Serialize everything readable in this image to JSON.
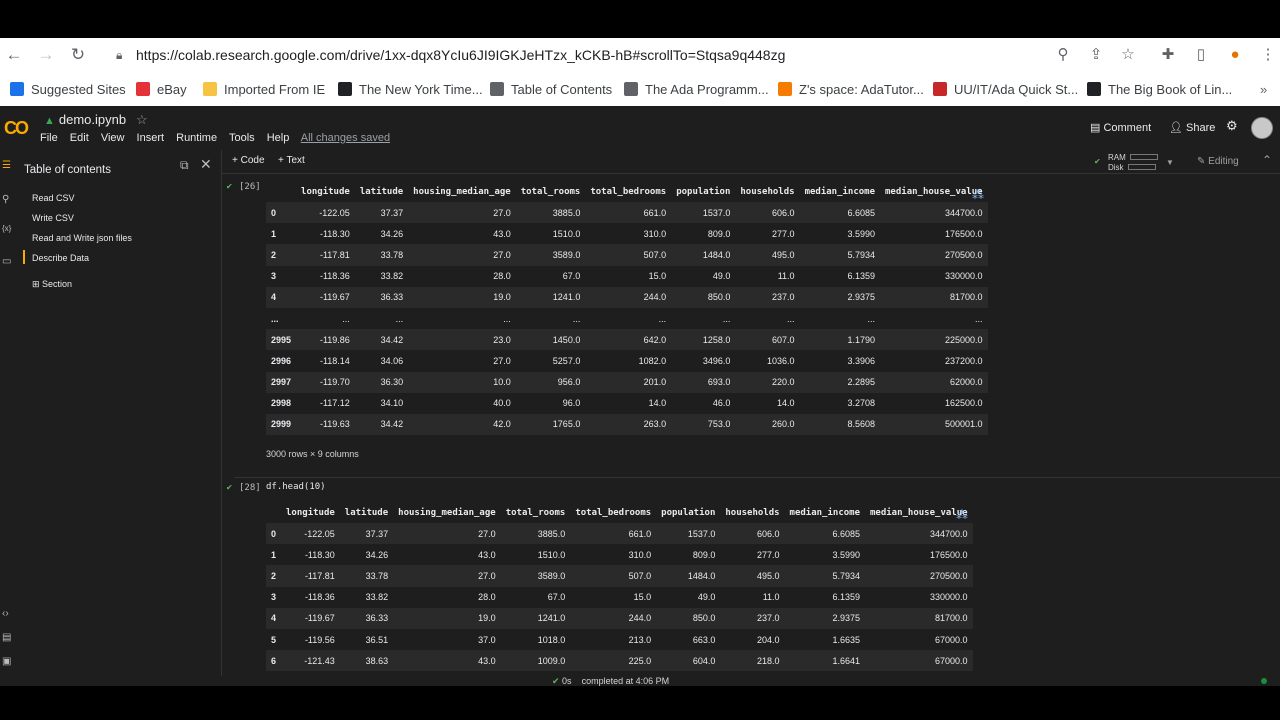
{
  "browser": {
    "url": "https://colab.research.google.com/drive/1xx-dqx8YcIu6JI9IGKJeHTzx_kCKB-hB#scrollTo=Stqsa9q448zg",
    "bookmarks": [
      {
        "label": "Suggested Sites",
        "color": "#1a73e8"
      },
      {
        "label": "eBay",
        "color": "#e53238"
      },
      {
        "label": "Imported From IE",
        "color": "#f6c343"
      },
      {
        "label": "The New York Time...",
        "color": "#202124"
      },
      {
        "label": "Table of Contents",
        "color": "#5f6368"
      },
      {
        "label": "The Ada Programm...",
        "color": "#5f6368"
      },
      {
        "label": "Z's space: AdaTutor...",
        "color": "#f57c00"
      },
      {
        "label": "UU/IT/Ada Quick St...",
        "color": "#c62828"
      },
      {
        "label": "The Big Book of Lin...",
        "color": "#202124"
      }
    ]
  },
  "colab": {
    "logo": "CO",
    "title": "demo.ipynb",
    "menus": [
      "File",
      "Edit",
      "View",
      "Insert",
      "Runtime",
      "Tools",
      "Help"
    ],
    "saved_status": "All changes saved",
    "comment_label": "Comment",
    "share_label": "Share",
    "add_code_label": "+ Code",
    "add_text_label": "+ Text",
    "ram_label": "RAM",
    "disk_label": "Disk",
    "editing_label": "Editing"
  },
  "sidebar": {
    "title": "Table of contents",
    "items": [
      "Read CSV",
      "Write CSV",
      "Read and Write json files",
      "Describe Data"
    ],
    "section_label": "Section"
  },
  "cell26": {
    "exec_label": "[26]",
    "columns": [
      "",
      "longitude",
      "latitude",
      "housing_median_age",
      "total_rooms",
      "total_bedrooms",
      "population",
      "households",
      "median_income",
      "median_house_value"
    ],
    "rows": [
      [
        "0",
        "-122.05",
        "37.37",
        "27.0",
        "3885.0",
        "661.0",
        "1537.0",
        "606.0",
        "6.6085",
        "344700.0"
      ],
      [
        "1",
        "-118.30",
        "34.26",
        "43.0",
        "1510.0",
        "310.0",
        "809.0",
        "277.0",
        "3.5990",
        "176500.0"
      ],
      [
        "2",
        "-117.81",
        "33.78",
        "27.0",
        "3589.0",
        "507.0",
        "1484.0",
        "495.0",
        "5.7934",
        "270500.0"
      ],
      [
        "3",
        "-118.36",
        "33.82",
        "28.0",
        "67.0",
        "15.0",
        "49.0",
        "11.0",
        "6.1359",
        "330000.0"
      ],
      [
        "4",
        "-119.67",
        "36.33",
        "19.0",
        "1241.0",
        "244.0",
        "850.0",
        "237.0",
        "2.9375",
        "81700.0"
      ],
      [
        "...",
        "...",
        "...",
        "...",
        "...",
        "...",
        "...",
        "...",
        "...",
        "..."
      ],
      [
        "2995",
        "-119.86",
        "34.42",
        "23.0",
        "1450.0",
        "642.0",
        "1258.0",
        "607.0",
        "1.1790",
        "225000.0"
      ],
      [
        "2996",
        "-118.14",
        "34.06",
        "27.0",
        "5257.0",
        "1082.0",
        "3496.0",
        "1036.0",
        "3.3906",
        "237200.0"
      ],
      [
        "2997",
        "-119.70",
        "36.30",
        "10.0",
        "956.0",
        "201.0",
        "693.0",
        "220.0",
        "2.2895",
        "62000.0"
      ],
      [
        "2998",
        "-117.12",
        "34.10",
        "40.0",
        "96.0",
        "14.0",
        "46.0",
        "14.0",
        "3.2708",
        "162500.0"
      ],
      [
        "2999",
        "-119.63",
        "34.42",
        "42.0",
        "1765.0",
        "263.0",
        "753.0",
        "260.0",
        "8.5608",
        "500001.0"
      ]
    ],
    "footer": "3000 rows × 9 columns"
  },
  "cell28": {
    "exec_label": "[28]",
    "code": "df.head(10)",
    "columns": [
      "",
      "longitude",
      "latitude",
      "housing_median_age",
      "total_rooms",
      "total_bedrooms",
      "population",
      "households",
      "median_income",
      "median_house_value"
    ],
    "rows": [
      [
        "0",
        "-122.05",
        "37.37",
        "27.0",
        "3885.0",
        "661.0",
        "1537.0",
        "606.0",
        "6.6085",
        "344700.0"
      ],
      [
        "1",
        "-118.30",
        "34.26",
        "43.0",
        "1510.0",
        "310.0",
        "809.0",
        "277.0",
        "3.5990",
        "176500.0"
      ],
      [
        "2",
        "-117.81",
        "33.78",
        "27.0",
        "3589.0",
        "507.0",
        "1484.0",
        "495.0",
        "5.7934",
        "270500.0"
      ],
      [
        "3",
        "-118.36",
        "33.82",
        "28.0",
        "67.0",
        "15.0",
        "49.0",
        "11.0",
        "6.1359",
        "330000.0"
      ],
      [
        "4",
        "-119.67",
        "36.33",
        "19.0",
        "1241.0",
        "244.0",
        "850.0",
        "237.0",
        "2.9375",
        "81700.0"
      ],
      [
        "5",
        "-119.56",
        "36.51",
        "37.0",
        "1018.0",
        "213.0",
        "663.0",
        "204.0",
        "1.6635",
        "67000.0"
      ],
      [
        "6",
        "-121.43",
        "38.63",
        "43.0",
        "1009.0",
        "225.0",
        "604.0",
        "218.0",
        "1.6641",
        "67000.0"
      ]
    ]
  },
  "status": {
    "duration": "0s",
    "message": "completed at 4:06 PM"
  }
}
